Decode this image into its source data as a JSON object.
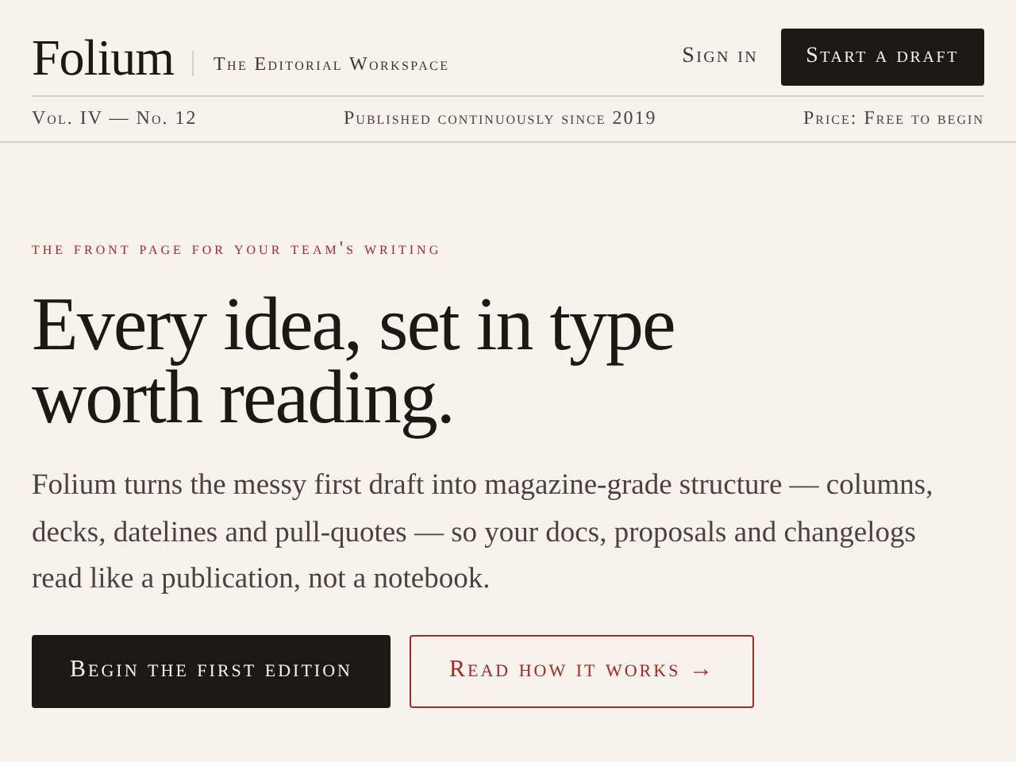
{
  "header": {
    "logo": "Folium",
    "tagline": "The Editorial Workspace",
    "sign_in": "Sign in",
    "cta": "Start a draft"
  },
  "dateline": {
    "volume": "Vol. IV — No. 12",
    "center": "Published continuously since 2019",
    "price": "Price: Free to begin"
  },
  "hero": {
    "eyebrow": "the front page for your team's writing",
    "headline_lines": [
      "Every idea, set in type",
      "worth reading."
    ],
    "body": "Folium turns the messy first draft into magazine-grade structure — columns, decks, datelines and pull-quotes — so your docs, proposals and changelogs read like a publication, not a notebook.",
    "buttons": [
      {
        "kind": "primary",
        "label": "Begin the first edition"
      },
      {
        "kind": "secondary",
        "label": "Read how it works →"
      }
    ]
  }
}
